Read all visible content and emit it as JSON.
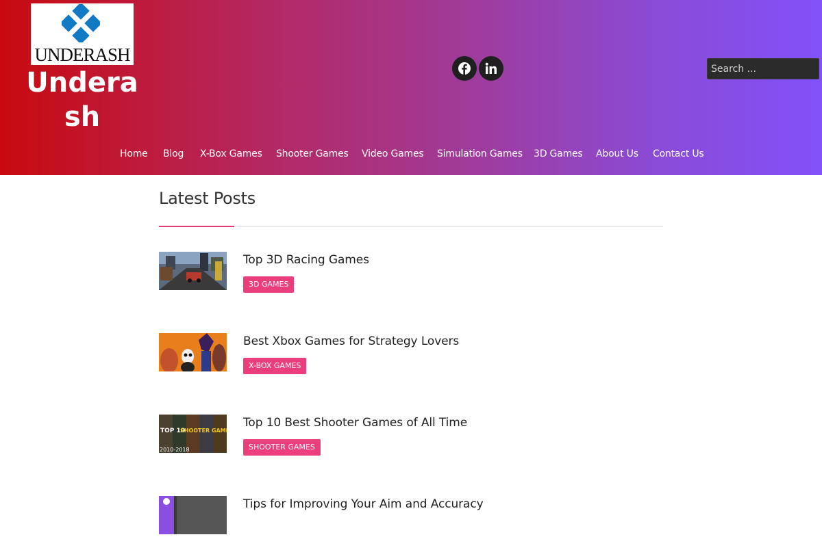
{
  "brand": {
    "logo_text": "UNDERASH",
    "site_title": "Underash"
  },
  "header": {
    "social": [
      {
        "name": "facebook-icon"
      },
      {
        "name": "linkedin-icon"
      }
    ],
    "search": {
      "placeholder": "Search ..."
    }
  },
  "nav": [
    "Home",
    "Blog",
    "X-Box Games",
    "Shooter Games",
    "Video Games",
    "Simulation Games",
    "3D Games",
    "About Us",
    "Contact Us"
  ],
  "main": {
    "section_title": "Latest Posts",
    "posts": [
      {
        "title": "Top 3D Racing Games",
        "category": "3D GAMES"
      },
      {
        "title": "Best Xbox Games for Strategy Lovers",
        "category": "X-BOX GAMES"
      },
      {
        "title": "Top 10 Best Shooter Games of All Time",
        "category": "SHOOTER GAMES"
      },
      {
        "title": "Tips for Improving Your Aim and Accuracy",
        "category": ""
      }
    ],
    "thumb3_text": [
      "TOP 10",
      "SHOOTER GAMES",
      "2010-2018"
    ]
  },
  "colors": {
    "tag": "#ea3f7c",
    "accent_rule": "#e43a72",
    "header_gradient_start": "#c80a0f",
    "header_gradient_end": "#8251fa"
  }
}
